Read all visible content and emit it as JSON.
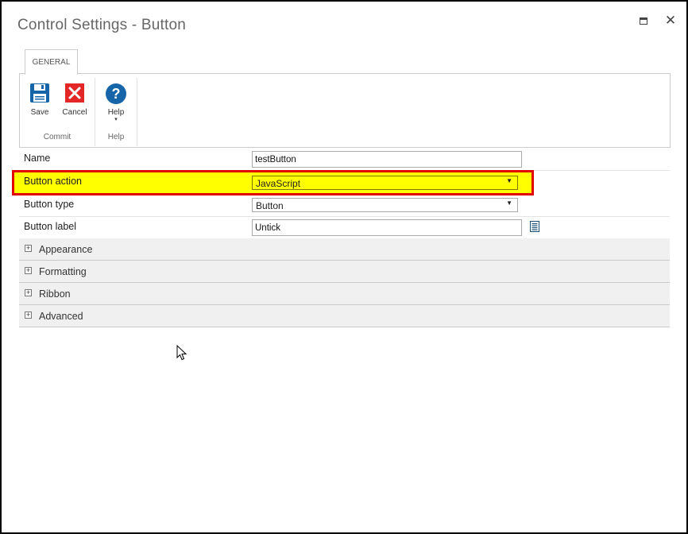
{
  "window": {
    "title": "Control Settings - Button",
    "maximize_glyph": "",
    "close_glyph": "✕"
  },
  "ribbon": {
    "tab_label": "GENERAL",
    "groups": [
      {
        "name": "Commit",
        "buttons": [
          {
            "label": "Save",
            "icon": "save-icon"
          },
          {
            "label": "Cancel",
            "icon": "cancel-icon"
          }
        ]
      },
      {
        "name": "Help",
        "buttons": [
          {
            "label": "Help",
            "icon": "help-icon",
            "dropdown_glyph": "▾"
          }
        ]
      }
    ]
  },
  "properties": {
    "name": {
      "label": "Name",
      "value": "testButton"
    },
    "button_action": {
      "label": "Button action",
      "value": "JavaScript",
      "arrow": "▼"
    },
    "button_type": {
      "label": "Button type",
      "value": "Button",
      "arrow": "▼"
    },
    "button_label": {
      "label": "Button label",
      "value": "Untick"
    }
  },
  "sections": [
    {
      "title": "Appearance",
      "toggle": "+"
    },
    {
      "title": "Formatting",
      "toggle": "+"
    },
    {
      "title": "Ribbon",
      "toggle": "+"
    },
    {
      "title": "Advanced",
      "toggle": "+"
    }
  ],
  "colors": {
    "highlight": "#ffff00",
    "highlight_border": "#e00000",
    "save_icon": "#1565a8",
    "cancel_icon": "#e32626",
    "help_icon": "#1565a8"
  }
}
